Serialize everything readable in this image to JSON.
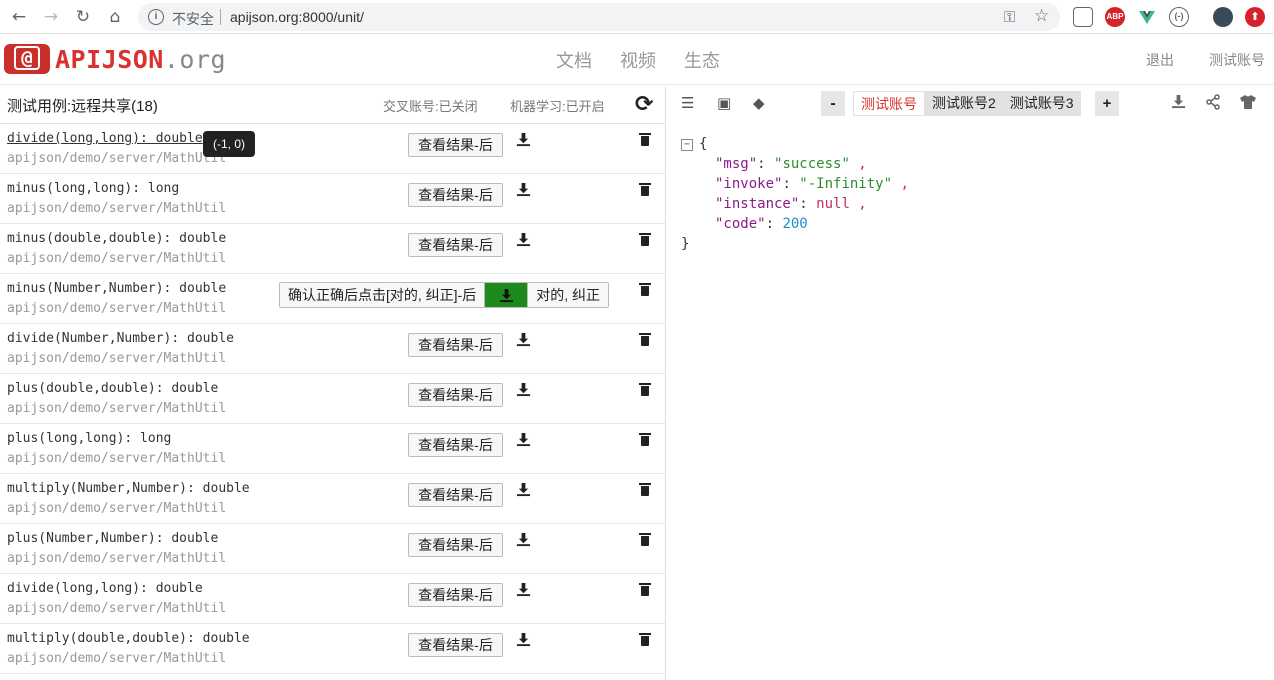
{
  "browser": {
    "insecure_label": "不安全",
    "url": "apijson.org:8000/unit/",
    "ext_abp": "ABP"
  },
  "header": {
    "logo_mark": "@",
    "logo_main": "APIJSON",
    "logo_suffix": ".org",
    "nav": [
      "文档",
      "视频",
      "生态"
    ],
    "logout": "退出",
    "account": "测试账号"
  },
  "left": {
    "title": "测试用例:远程共享(18)",
    "option_cross": "交叉账号:已关闭",
    "option_ml": "机器学习:已开启",
    "view_label": "查看结果-后",
    "confirm_label": "确认正确后点击[对的, 纠正]-后",
    "correct_label": "对的, 纠正",
    "tooltip": "(-1, 0)",
    "cases": [
      {
        "name": "divide(long,long): double",
        "path": "apijson/demo/server/MathUtil"
      },
      {
        "name": "minus(long,long): long",
        "path": "apijson/demo/server/MathUtil"
      },
      {
        "name": "minus(double,double): double",
        "path": "apijson/demo/server/MathUtil"
      },
      {
        "name": "minus(Number,Number): double",
        "path": "apijson/demo/server/MathUtil"
      },
      {
        "name": "divide(Number,Number): double",
        "path": "apijson/demo/server/MathUtil"
      },
      {
        "name": "plus(double,double): double",
        "path": "apijson/demo/server/MathUtil"
      },
      {
        "name": "plus(long,long): long",
        "path": "apijson/demo/server/MathUtil"
      },
      {
        "name": "multiply(Number,Number): double",
        "path": "apijson/demo/server/MathUtil"
      },
      {
        "name": "plus(Number,Number): double",
        "path": "apijson/demo/server/MathUtil"
      },
      {
        "name": "divide(long,long): double",
        "path": "apijson/demo/server/MathUtil"
      },
      {
        "name": "multiply(double,double): double",
        "path": "apijson/demo/server/MathUtil"
      }
    ]
  },
  "right": {
    "minus": "-",
    "plus": "+",
    "accounts": [
      "测试账号",
      "测试账号2",
      "测试账号3"
    ],
    "json": {
      "open": "{",
      "close": "}",
      "lines": [
        {
          "key": "\"msg\"",
          "value": "\"success\"",
          "type": "s"
        },
        {
          "key": "\"invoke\"",
          "value": "\"-Infinity\"",
          "type": "s"
        },
        {
          "key": "\"instance\"",
          "value": "null",
          "type": "nl"
        },
        {
          "key": "\"code\"",
          "value": "200",
          "type": "n"
        }
      ]
    }
  }
}
